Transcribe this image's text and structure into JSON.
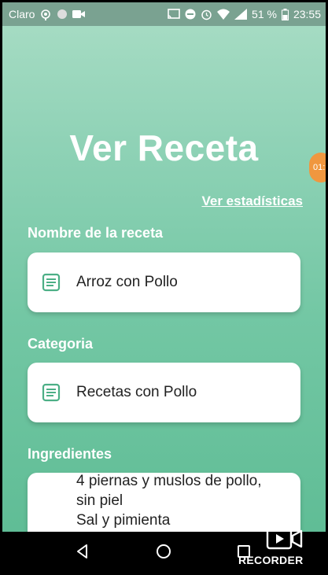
{
  "status_bar": {
    "carrier": "Claro",
    "battery": "51 %",
    "time": "23:55"
  },
  "page": {
    "title": "Ver Receta",
    "stats_link": "Ver estadísticas",
    "float_badge": "01:"
  },
  "recipe": {
    "name_label": "Nombre de la receta",
    "name_value": "Arroz con Pollo",
    "category_label": "Categoria",
    "category_value": "Recetas con Pollo",
    "ingredients_label": "Ingredientes",
    "ingredients_value": "4 piernas y muslos de pollo,\nsin piel\nSal y pimienta"
  },
  "overlay": {
    "recorder_label": "RECORDER"
  },
  "colors": {
    "accent": "#4caf86",
    "badge": "#f0973f"
  }
}
